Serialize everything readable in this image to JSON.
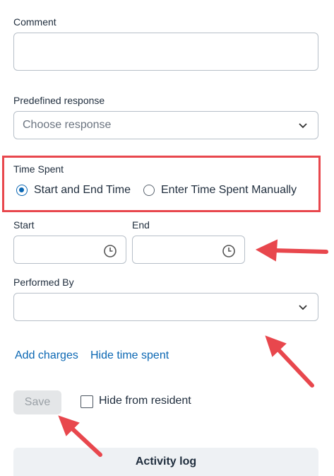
{
  "comment": {
    "label": "Comment",
    "value": ""
  },
  "predefined_response": {
    "label": "Predefined response",
    "placeholder": "Choose response",
    "icon": "chevron-down-icon"
  },
  "time_spent": {
    "label": "Time Spent",
    "options": [
      {
        "label": "Start and End Time",
        "selected": true
      },
      {
        "label": "Enter Time Spent Manually",
        "selected": false
      }
    ]
  },
  "start": {
    "label": "Start",
    "value": "",
    "icon": "clock-icon"
  },
  "end": {
    "label": "End",
    "value": "",
    "icon": "clock-icon"
  },
  "performed_by": {
    "label": "Performed By",
    "value": "",
    "icon": "chevron-down-icon"
  },
  "links": {
    "add_charges": "Add charges",
    "hide_time_spent": "Hide time spent"
  },
  "save_button": {
    "label": "Save",
    "disabled": true
  },
  "hide_from_resident": {
    "label": "Hide from resident",
    "checked": false
  },
  "activity_log": {
    "label": "Activity log"
  },
  "colors": {
    "accent": "#0b67b3",
    "annotation": "#e8474d"
  }
}
